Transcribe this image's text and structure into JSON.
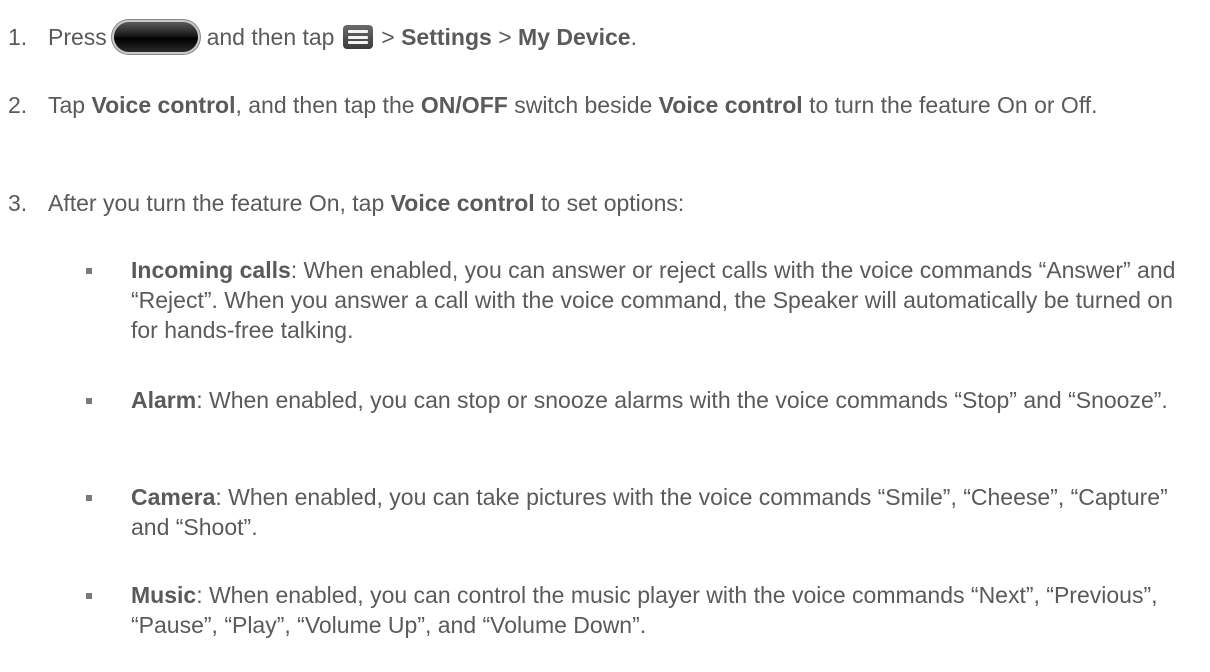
{
  "steps": [
    {
      "number": "1.",
      "parts": {
        "t1": "Press",
        "t2": "and then tap",
        "t3": ">",
        "b1": "Settings",
        "t4": ">",
        "b2": "My Device",
        "t5": "."
      }
    },
    {
      "number": "2.",
      "parts": {
        "t1": "Tap",
        "b1": "Voice control",
        "t2": ", and then tap the",
        "b2": "ON/OFF",
        "t3": "switch beside",
        "b3": "Voice control",
        "t4": "to turn the feature On or Off."
      }
    },
    {
      "number": "3.",
      "parts": {
        "t1": "After you turn the feature On, tap",
        "b1": "Voice control",
        "t2": "to set options:"
      }
    }
  ],
  "options": [
    {
      "name": "Incoming calls",
      "text": ": When enabled, you can answer or reject calls with the voice commands “Answer” and “Reject”. When you answer a call with the voice command, the Speaker will automatically be turned on for hands-free talking."
    },
    {
      "name": "Alarm",
      "text": ": When enabled, you can stop or snooze alarms with the voice commands “Stop” and “Snooze”."
    },
    {
      "name": "Camera",
      "text": ": When enabled, you can take pictures with the voice commands “Smile”, “Cheese”, “Capture” and “Shoot”."
    },
    {
      "name": "Music",
      "text": ": When enabled, you can control the music player with the voice commands “Next”, “Previous”, “Pause”, “Play”, “Volume Up”, and “Volume Down”."
    }
  ],
  "icons": {
    "home_key": "home-key-icon",
    "menu_key": "menu-key-icon"
  }
}
